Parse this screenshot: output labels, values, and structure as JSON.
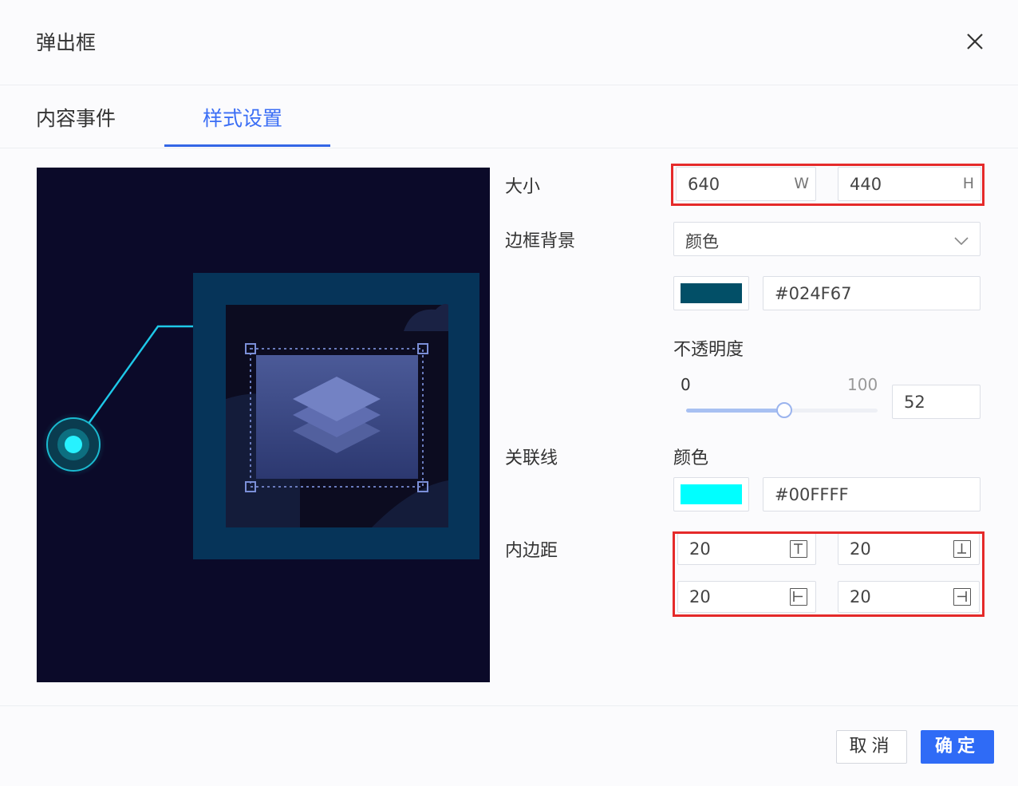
{
  "dialog": {
    "title": "弹出框"
  },
  "tabs": [
    {
      "label": "内容事件",
      "active": false
    },
    {
      "label": "样式设置",
      "active": true
    }
  ],
  "form": {
    "size": {
      "label": "大小",
      "width": "640",
      "width_unit": "W",
      "height": "440",
      "height_unit": "H"
    },
    "border_bg": {
      "label": "边框背景",
      "type_value": "颜色",
      "color": "#024F67",
      "opacity": {
        "label": "不透明度",
        "min": "0",
        "max": "100",
        "value": "52"
      }
    },
    "link_line": {
      "label": "关联线",
      "sublabel": "颜色",
      "color": "#00FFFF"
    },
    "padding": {
      "label": "内边距",
      "top": "20",
      "bottom": "20",
      "left": "20",
      "right": "20"
    }
  },
  "footer": {
    "cancel_label": "取消",
    "ok_label": "确定"
  },
  "colors": {
    "accent": "#2F6BF6",
    "highlight_border": "#E52A2A",
    "preview_bg": "#0B0A29",
    "swatch_border": "#024F67",
    "swatch_line": "#00FFFF"
  }
}
